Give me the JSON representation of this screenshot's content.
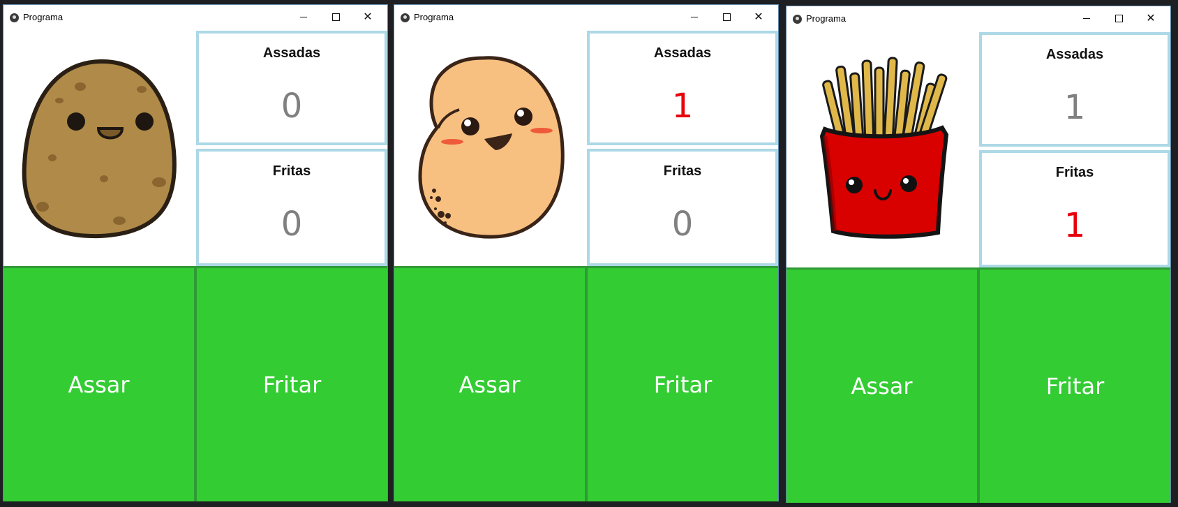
{
  "colors": {
    "button_green": "#33cc33",
    "border_blue": "#add8e6",
    "value_gray": "#808080",
    "value_red": "#e8000b"
  },
  "windows": [
    {
      "title": "Programa",
      "image": "brown-potato-icon",
      "assadas_label": "Assadas",
      "assadas_value": "0",
      "fritas_label": "Fritas",
      "fritas_value": "0",
      "assar_label": "Assar",
      "fritar_label": "Fritar"
    },
    {
      "title": "Programa",
      "image": "baked-potato-icon",
      "assadas_label": "Assadas",
      "assadas_value": "1",
      "fritas_label": "Fritas",
      "fritas_value": "0",
      "assar_label": "Assar",
      "fritar_label": "Fritar"
    },
    {
      "title": "Programa",
      "image": "french-fries-icon",
      "assadas_label": "Assadas",
      "assadas_value": "1",
      "fritas_label": "Fritas",
      "fritas_value": "1",
      "assar_label": "Assar",
      "fritar_label": "Fritar"
    }
  ]
}
